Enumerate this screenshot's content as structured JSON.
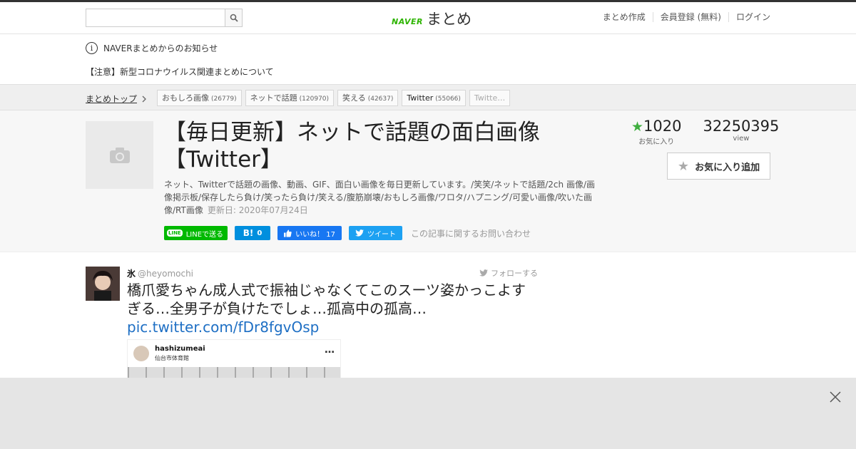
{
  "header": {
    "search_placeholder": "",
    "logo_naver": "NAVER",
    "logo_matome": "まとめ",
    "nav": [
      "まとめ作成",
      "会員登録 (無料)",
      "ログイン"
    ]
  },
  "notice": {
    "title": "NAVERまとめからのお知らせ",
    "item": "【注意】新型コロナウイルス関連まとめについて"
  },
  "breadcrumb": {
    "top_label": "まとめトップ",
    "tags": [
      {
        "label": "おもしろ画像",
        "count": "(26779)"
      },
      {
        "label": "ネットで話題",
        "count": "(120970)"
      },
      {
        "label": "笑える",
        "count": "(42637)"
      },
      {
        "label": "Twitter",
        "count": "(55066)"
      },
      {
        "label": "Twitte…",
        "count": ""
      }
    ]
  },
  "article": {
    "title": "【毎日更新】ネットで話題の面白画像【Twitter】",
    "description": "ネット、Twitterで話題の画像、動画、GIF、面白い画像を毎日更新しています。/笑笑/ネットで話題/2ch 画像/画像掲示板/保存したら負け/笑ったら負け/笑える/腹筋崩壊/おもしろ画像/ワロタ/ハプニング/可愛い画像/吹いた画像/RT画像",
    "updated": "更新日: 2020年07月24日",
    "favorites": "1020",
    "favorites_label": "お気に入り",
    "views": "32250395",
    "views_label": "view",
    "fav_button": "お気に入り追加",
    "share": {
      "line_badge": "LINE",
      "line": "LINEで送る",
      "hatena_count": "0",
      "fb_like": "いいね！ 17",
      "tweet": "ツイート",
      "contact": "この記事に関するお問い合わせ"
    }
  },
  "tweet": {
    "name": "氷",
    "handle": "@heyomochi",
    "follow": "フォローする",
    "text": "橋爪愛ちゃん成人式で振袖じゃなくてこのスーツ姿かっこよすぎる…全男子が負けたでしょ…孤高中の孤高…",
    "link": "pic.twitter.com/fDr8fgvOsp",
    "image_user": "hashizumeai",
    "image_location": "仙台市体育館",
    "image_more": "…"
  },
  "colors": {
    "accent_green": "#2db400",
    "link_blue": "#1e6fc4",
    "line_green": "#00b900",
    "hatena_blue": "#008fde",
    "facebook_blue": "#1877f2",
    "twitter_blue": "#1da1f2"
  }
}
